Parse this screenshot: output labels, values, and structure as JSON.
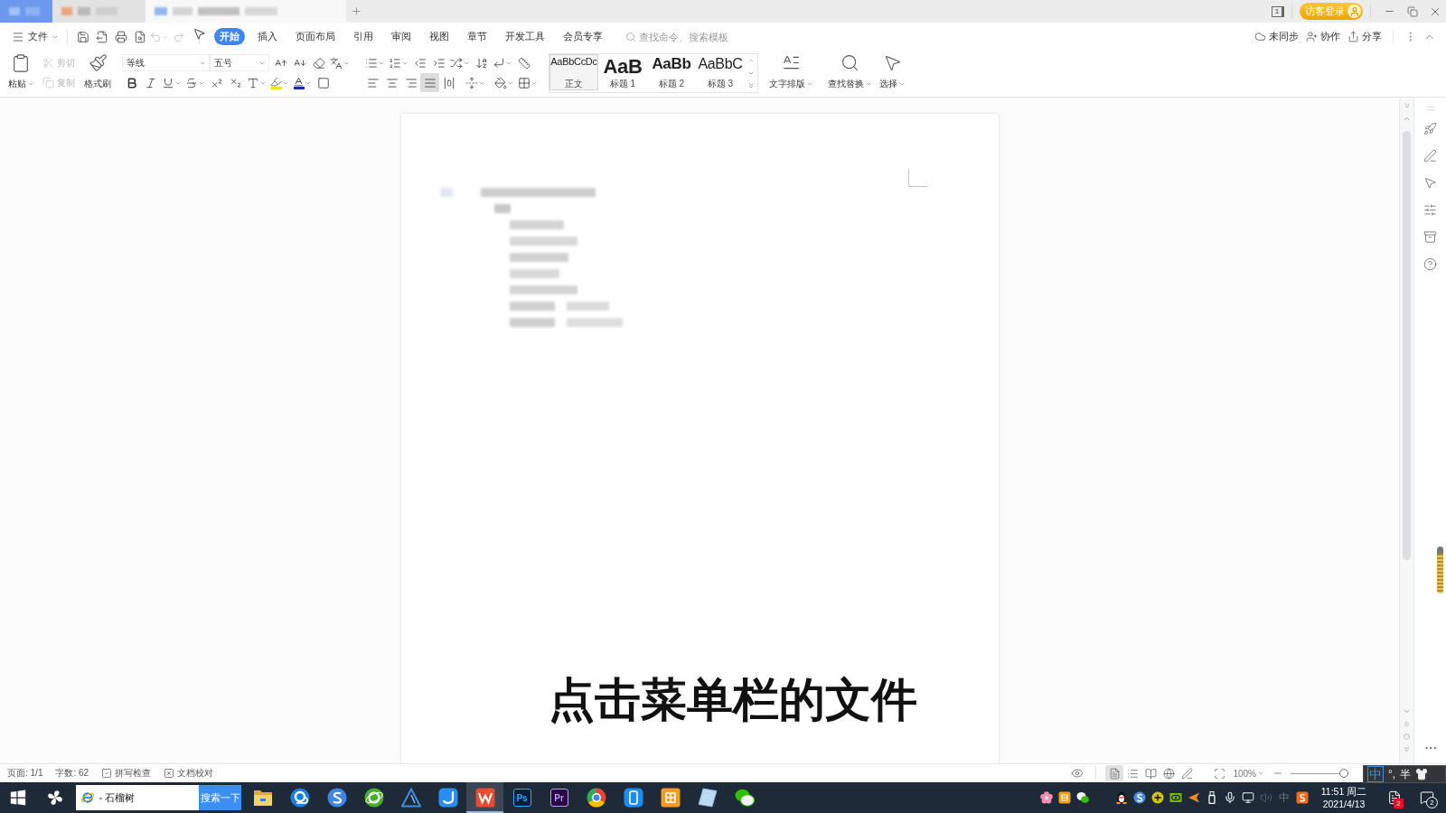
{
  "title_bar": {
    "tabs": [
      {
        "kind": "home",
        "selected": false
      },
      {
        "kind": "document",
        "selected": false
      },
      {
        "kind": "document",
        "selected": true
      }
    ],
    "window_count": "1",
    "login_button": "访客登录"
  },
  "menu_bar": {
    "file_menu": "文件",
    "tabs": [
      {
        "label": "开始",
        "selected": true
      },
      {
        "label": "插入",
        "selected": false
      },
      {
        "label": "页面布局",
        "selected": false
      },
      {
        "label": "引用",
        "selected": false
      },
      {
        "label": "审阅",
        "selected": false
      },
      {
        "label": "视图",
        "selected": false
      },
      {
        "label": "章节",
        "selected": false
      },
      {
        "label": "开发工具",
        "selected": false
      },
      {
        "label": "会员专享",
        "selected": false
      }
    ],
    "search": {
      "placeholder": "查找命令、搜索模板"
    },
    "actions": [
      {
        "kind": "sync",
        "label": "未同步"
      },
      {
        "kind": "collaborate",
        "label": "协作"
      },
      {
        "kind": "share",
        "label": "分享"
      }
    ]
  },
  "ribbon": {
    "paste": "粘贴",
    "clipboard": [
      {
        "kind": "cut",
        "label": "剪切",
        "disabled": true
      },
      {
        "kind": "copy",
        "label": "复制",
        "disabled": true
      }
    ],
    "format_painter": "格式刷",
    "font_name": "等线",
    "font_size": "五号",
    "alignment": [
      {
        "kind": "left",
        "selected": false
      },
      {
        "kind": "center",
        "selected": false
      },
      {
        "kind": "right",
        "selected": false
      },
      {
        "kind": "justify",
        "selected": true
      },
      {
        "kind": "distributed",
        "selected": false
      }
    ],
    "styles": [
      {
        "kind": "body",
        "preview": "AaBbCcDc",
        "label": "正文",
        "selected": true
      },
      {
        "kind": "heading1",
        "preview": "AaB",
        "label": "标题 1",
        "selected": false
      },
      {
        "kind": "heading2",
        "preview": "AaBb",
        "label": "标题 2",
        "selected": false
      },
      {
        "kind": "heading3",
        "preview": "AaBbC",
        "label": "标题 3",
        "selected": false
      }
    ],
    "tools": [
      {
        "kind": "text-layout",
        "label": "文字排版"
      },
      {
        "kind": "find-replace",
        "label": "查找替换"
      },
      {
        "kind": "select",
        "label": "选择"
      }
    ]
  },
  "document": {
    "caption": "点击菜单栏的文件"
  },
  "status_bar": {
    "page": "页面: 1/1",
    "word_count": "字数: 62",
    "checks": [
      {
        "kind": "spell",
        "label": "拼写检查"
      },
      {
        "kind": "proofread",
        "label": "文档校对"
      }
    ],
    "views": [
      {
        "kind": "page",
        "selected": true
      },
      {
        "kind": "outline",
        "selected": false
      },
      {
        "kind": "reading",
        "selected": false
      },
      {
        "kind": "web",
        "selected": false
      },
      {
        "kind": "write",
        "selected": false
      }
    ],
    "zoom": {
      "reading": "100%",
      "level": 0.95
    }
  },
  "ime_toolbar": {
    "mode": "中",
    "punctuation": "°,",
    "width": "半"
  },
  "taskbar": {
    "search": {
      "value": "石榴树",
      "button": "搜索一下"
    },
    "apps": [
      {
        "kind": "folder",
        "selected": false
      },
      {
        "kind": "cloud-browser",
        "selected": false
      },
      {
        "kind": "s-browser",
        "selected": false
      },
      {
        "kind": "e-browser",
        "selected": false
      },
      {
        "kind": "triangle",
        "selected": false
      },
      {
        "kind": "d-app",
        "selected": false
      },
      {
        "kind": "wps",
        "selected": true
      },
      {
        "kind": "ps",
        "label": "Ps",
        "selected": false
      },
      {
        "kind": "pr",
        "label": "Pr",
        "selected": false
      },
      {
        "kind": "color-wheel",
        "selected": false
      },
      {
        "kind": "phone",
        "selected": false
      },
      {
        "kind": "orange-grid",
        "selected": false
      },
      {
        "kind": "notepad",
        "selected": false
      },
      {
        "kind": "chat",
        "selected": false
      }
    ],
    "tray": {
      "extra": [
        {
          "kind": "flower"
        },
        {
          "kind": "orange-app"
        },
        {
          "kind": "chat"
        }
      ],
      "icons": [
        {
          "kind": "penguin"
        },
        {
          "kind": "s-circle"
        },
        {
          "kind": "plus-circle"
        },
        {
          "kind": "gpu"
        },
        {
          "kind": "arrow"
        },
        {
          "kind": "usb"
        },
        {
          "kind": "mic"
        },
        {
          "kind": "network"
        },
        {
          "kind": "volume"
        },
        {
          "kind": "ime",
          "label": "中"
        },
        {
          "kind": "s-tile"
        }
      ]
    },
    "clock": {
      "time": "11:51 周二",
      "date": "2021/4/13"
    },
    "notifications": [
      {
        "kind": "messages",
        "badge": "2"
      },
      {
        "kind": "action-center",
        "badge": "2"
      }
    ]
  }
}
